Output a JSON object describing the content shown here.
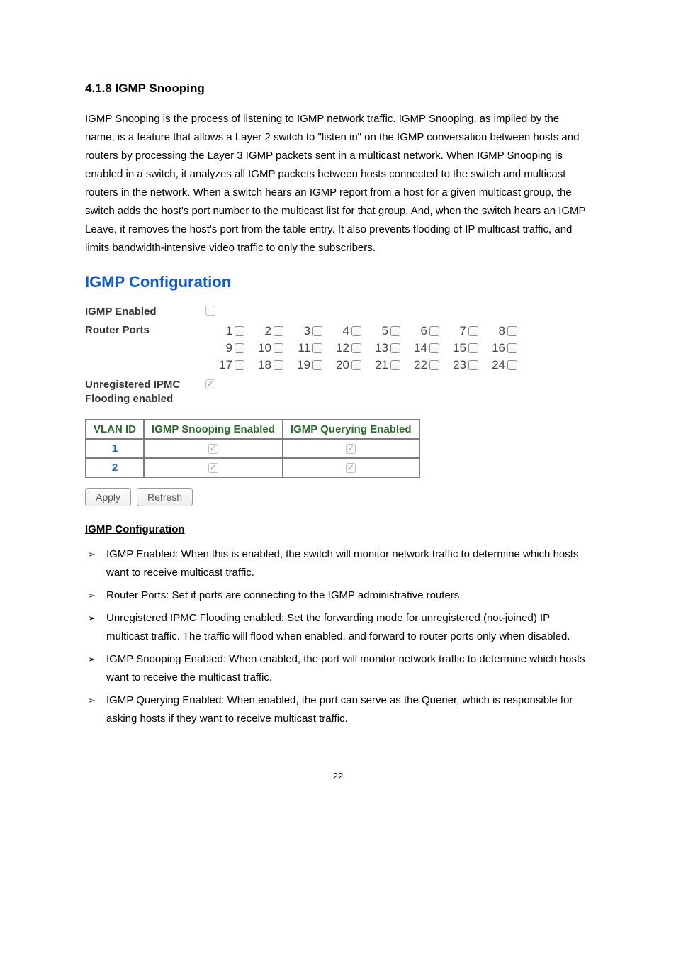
{
  "heading": "4.1.8 IGMP Snooping",
  "intro": "IGMP Snooping is the process of listening to IGMP network traffic. IGMP Snooping, as implied by the name, is a feature that allows a Layer 2 switch to \"listen in\" on the IGMP conversation between hosts and routers by processing the Layer 3 IGMP packets sent in a multicast network. When IGMP Snooping is enabled in a switch, it analyzes all IGMP packets between hosts connected to the switch and multicast routers in the network. When a switch hears an IGMP report from a host for a given multicast group, the switch adds the host's port number to the multicast list for that group. And, when the switch hears an IGMP Leave, it removes the host's port from the table entry. It also prevents flooding of IP multicast traffic, and limits bandwidth-intensive video traffic to only the subscribers.",
  "config_title": "IGMP Configuration",
  "labels": {
    "igmp_enabled": "IGMP Enabled",
    "router_ports": "Router Ports",
    "unreg": "Unregistered IPMC Flooding enabled"
  },
  "ports": {
    "row1": [
      "1",
      "2",
      "3",
      "4",
      "5",
      "6",
      "7",
      "8"
    ],
    "row2": [
      "9",
      "10",
      "11",
      "12",
      "13",
      "14",
      "15",
      "16"
    ],
    "row3": [
      "17",
      "18",
      "19",
      "20",
      "21",
      "22",
      "23",
      "24"
    ]
  },
  "table": {
    "headers": {
      "vlan": "VLAN ID",
      "snoop": "IGMP Snooping Enabled",
      "query": "IGMP Querying Enabled"
    },
    "rows": [
      {
        "id": "1"
      },
      {
        "id": "2"
      }
    ]
  },
  "buttons": {
    "apply": "Apply",
    "refresh": "Refresh"
  },
  "subhead": "IGMP Configuration",
  "bullets": [
    "IGMP Enabled: When this is enabled, the switch will monitor network traffic to determine which hosts want to receive multicast traffic.",
    "Router Ports: Set if ports are connecting to the IGMP administrative routers.",
    "Unregistered IPMC Flooding enabled: Set the forwarding mode for unregistered (not-joined) IP multicast traffic. The traffic will flood when enabled, and forward to router ports only when disabled.",
    "IGMP Snooping Enabled: When enabled, the port will monitor network traffic to determine which hosts want to receive the multicast traffic.",
    "IGMP Querying Enabled: When enabled, the port can serve as the Querier, which is responsible for asking hosts if they want to receive multicast traffic."
  ],
  "page_number": "22"
}
